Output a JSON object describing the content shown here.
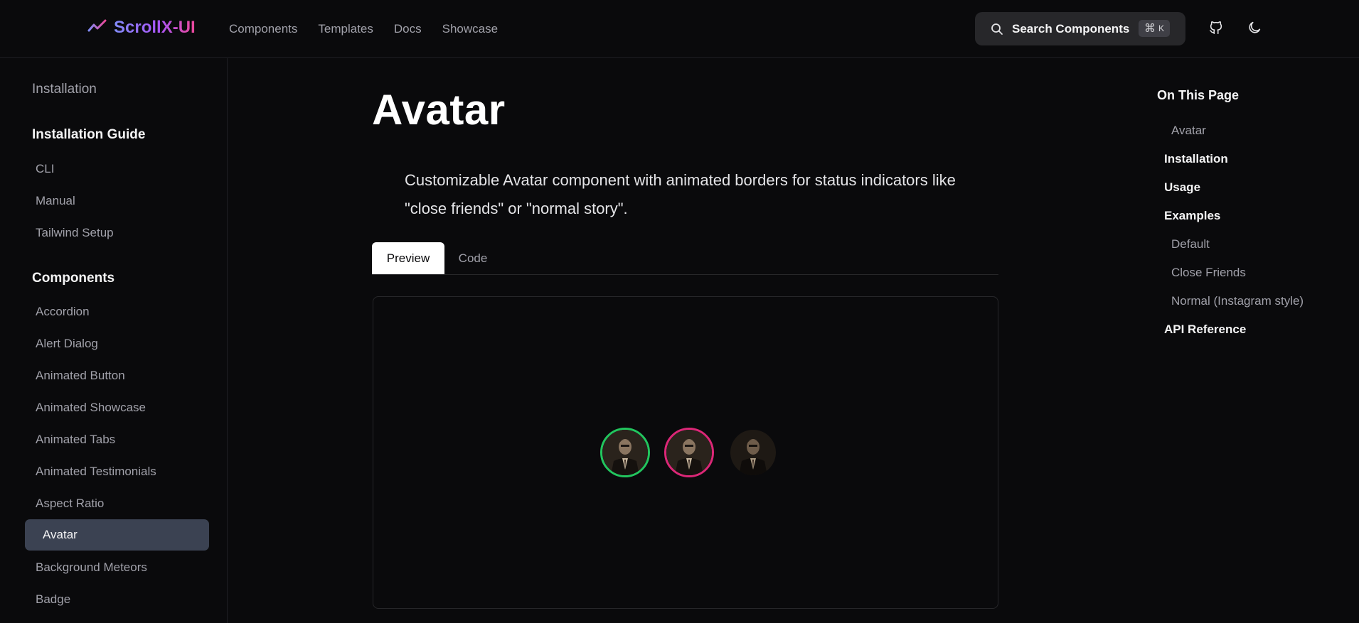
{
  "header": {
    "brand": "ScrollX-UI",
    "nav": [
      "Components",
      "Templates",
      "Docs",
      "Showcase"
    ],
    "search": {
      "label": "Search Components",
      "shortcut_symbol": "⌘",
      "shortcut_key": "K"
    }
  },
  "sidebar": {
    "installation": "Installation",
    "guide_heading": "Installation Guide",
    "guide_items": [
      "CLI",
      "Manual",
      "Tailwind Setup"
    ],
    "components_heading": "Components",
    "component_items": [
      "Accordion",
      "Alert Dialog",
      "Animated Button",
      "Animated Showcase",
      "Animated Tabs",
      "Animated Testimonials",
      "Aspect Ratio"
    ],
    "active_item": "Avatar",
    "after_items": [
      "Background Meteors",
      "Badge"
    ]
  },
  "main": {
    "title": "Avatar",
    "description": "Customizable Avatar component with animated borders for status indicators like \"close friends\" or \"normal story\".",
    "tabs": [
      "Preview",
      "Code"
    ],
    "active_tab": "Preview"
  },
  "preview": {
    "avatars": [
      {
        "variant": "close-friends",
        "ring_color": "#22c55e"
      },
      {
        "variant": "normal-story",
        "ring_color": "#db2777"
      },
      {
        "variant": "default",
        "ring_color": "none"
      }
    ]
  },
  "toc": {
    "title": "On This Page",
    "items": [
      {
        "label": "Avatar",
        "level": "sub"
      },
      {
        "label": "Installation",
        "level": "main"
      },
      {
        "label": "Usage",
        "level": "main"
      },
      {
        "label": "Examples",
        "level": "main"
      },
      {
        "label": "Default",
        "level": "sub"
      },
      {
        "label": "Close Friends",
        "level": "sub"
      },
      {
        "label": "Normal (Instagram style)",
        "level": "sub"
      },
      {
        "label": "API Reference",
        "level": "main"
      }
    ]
  },
  "colors": {
    "background": "#0a0a0c",
    "brand_gradient_start": "#818cf8",
    "brand_gradient_end": "#ec4899",
    "active_sidebar": "#3b4252"
  }
}
